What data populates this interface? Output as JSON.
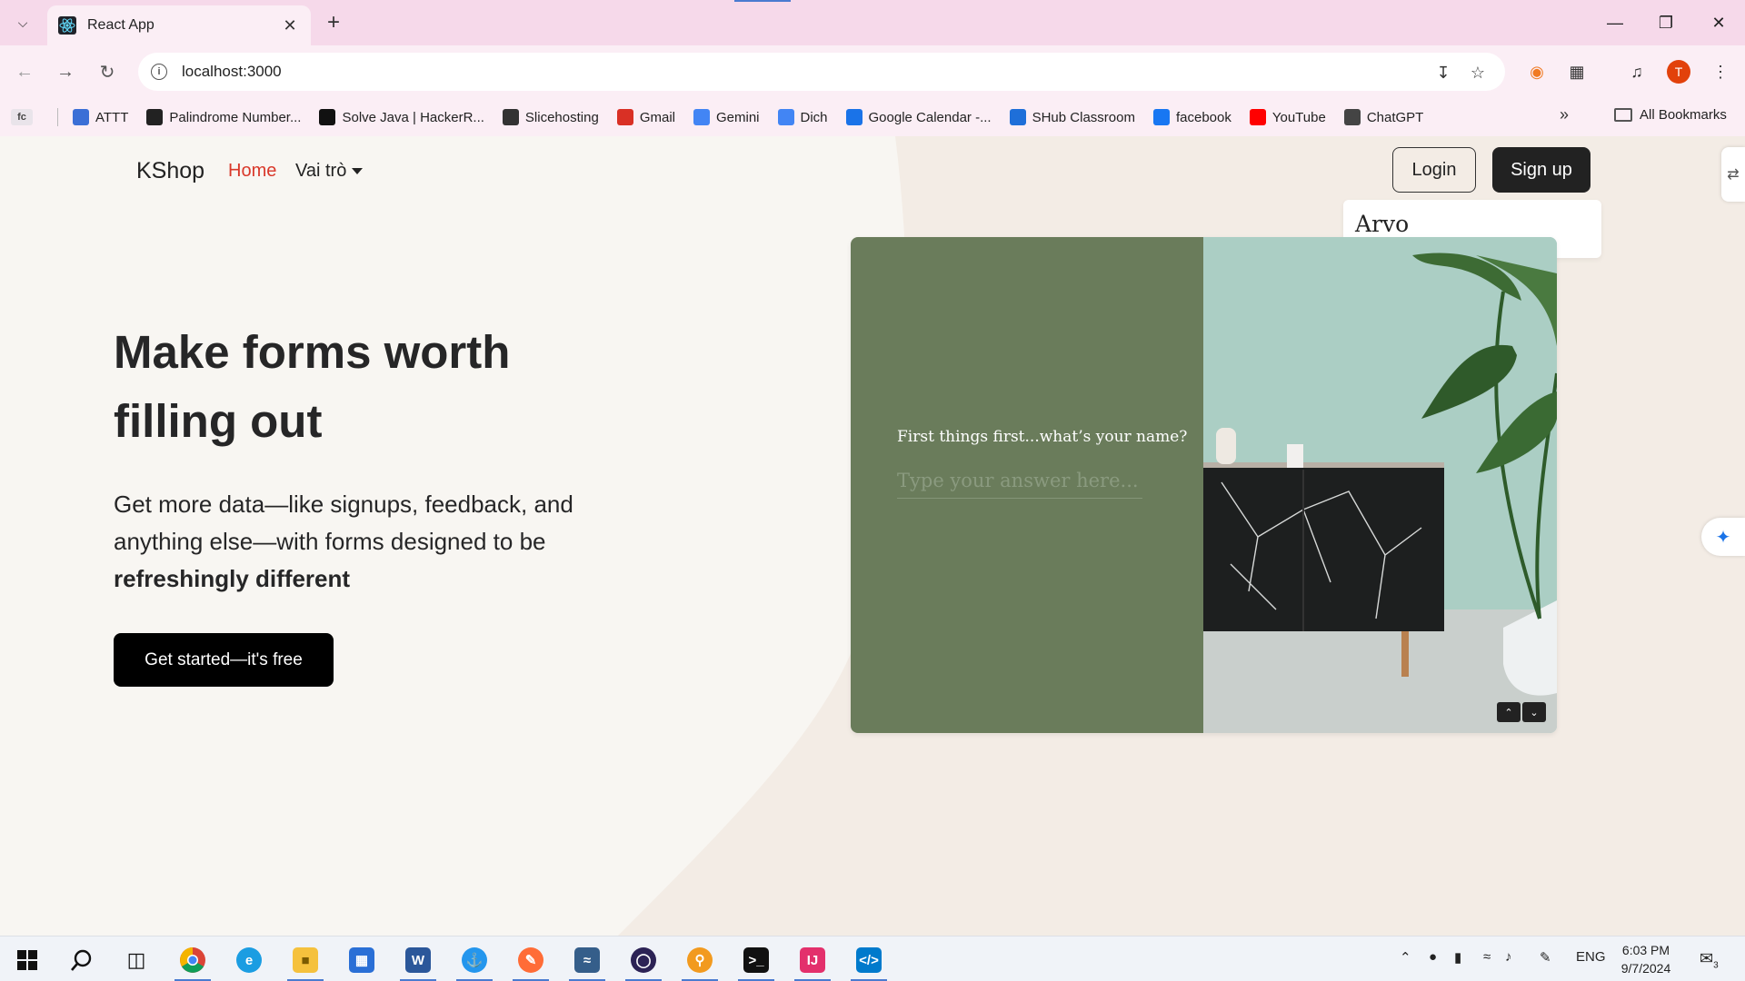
{
  "browser": {
    "tab_title": "React App",
    "url": "localhost:3000",
    "bookmarks": [
      {
        "label": "ATTT",
        "color": "#3b6fd6"
      },
      {
        "label": "Palindrome Number...",
        "color": "#222222"
      },
      {
        "label": "Solve Java | HackerR...",
        "color": "#111111"
      },
      {
        "label": "Slicehosting",
        "color": "#333333"
      },
      {
        "label": "Gmail",
        "color": "#d93025"
      },
      {
        "label": "Gemini",
        "color": "#4285f4"
      },
      {
        "label": "Dich",
        "color": "#4285f4"
      },
      {
        "label": "Google Calendar -...",
        "color": "#1a73e8"
      },
      {
        "label": "SHub Classroom",
        "color": "#1e6fd9"
      },
      {
        "label": "facebook",
        "color": "#1877f2"
      },
      {
        "label": "YouTube",
        "color": "#ff0000"
      },
      {
        "label": "ChatGPT",
        "color": "#444444"
      }
    ],
    "bookmark_first": "fc",
    "all_bookmarks": "All Bookmarks",
    "avatar_letter": "T"
  },
  "page": {
    "brand": "KShop",
    "nav_home": "Home",
    "nav_role": "Vai trò",
    "login": "Login",
    "signup": "Sign up",
    "font_popup": "Arvo",
    "hero_title": "Make forms worth filling out",
    "hero_sub_plain": "Get more data—like signups, feedback, and anything else—with forms designed to be ",
    "hero_sub_bold": "refreshingly different",
    "cta": "Get started—it's free",
    "demo_question": "First things first...what’s your name?",
    "demo_placeholder": "Type your answer here..."
  },
  "taskbar": {
    "lang": "ENG",
    "time": "6:03 PM",
    "date": "9/7/2024",
    "notif_count": "3"
  },
  "colors": {
    "accent_home": "#d9382a",
    "demo_green": "#6a7c5b",
    "demo_mint": "#a9cdc2"
  }
}
